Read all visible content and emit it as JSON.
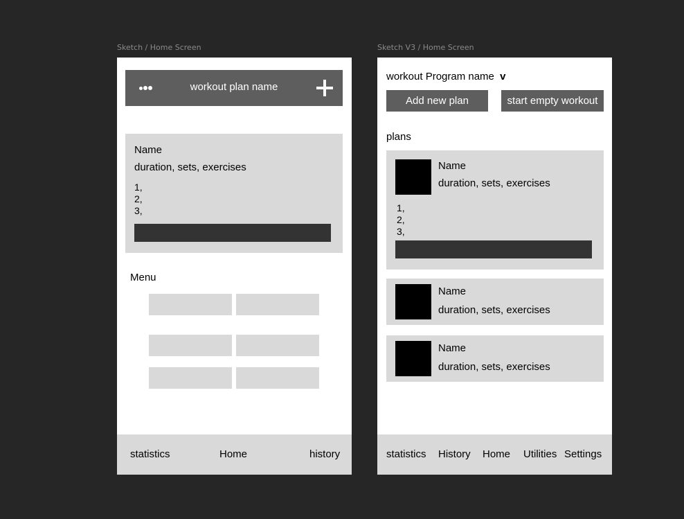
{
  "frame1": {
    "label": "Sketch / Home Screen",
    "topbar": {
      "title": "workout plan name",
      "menu_icon": "ellipsis-icon",
      "add_icon": "plus-icon"
    },
    "card": {
      "name": "Name",
      "meta": "duration, sets, exercises",
      "list": [
        "1,",
        "2,",
        "3,"
      ]
    },
    "menu_label": "Menu",
    "nav": [
      "statistics",
      "Home",
      "history"
    ]
  },
  "frame2": {
    "label": "Sketch V3 / Home Screen",
    "program_name": "workout Program name",
    "program_chevron": "v",
    "buttons": {
      "add_plan": "Add new plan",
      "start_empty": "start empty workout"
    },
    "plans_label": "plans",
    "plans": [
      {
        "name": "Name",
        "meta": "duration, sets, exercises",
        "list": [
          "1,",
          "2,",
          "3,"
        ]
      },
      {
        "name": "Name",
        "meta": "duration, sets, exercises"
      },
      {
        "name": "Name",
        "meta": "duration, sets, exercises"
      }
    ],
    "nav": [
      "statistics",
      "History",
      "Home",
      "Utilities",
      "Settings"
    ]
  }
}
